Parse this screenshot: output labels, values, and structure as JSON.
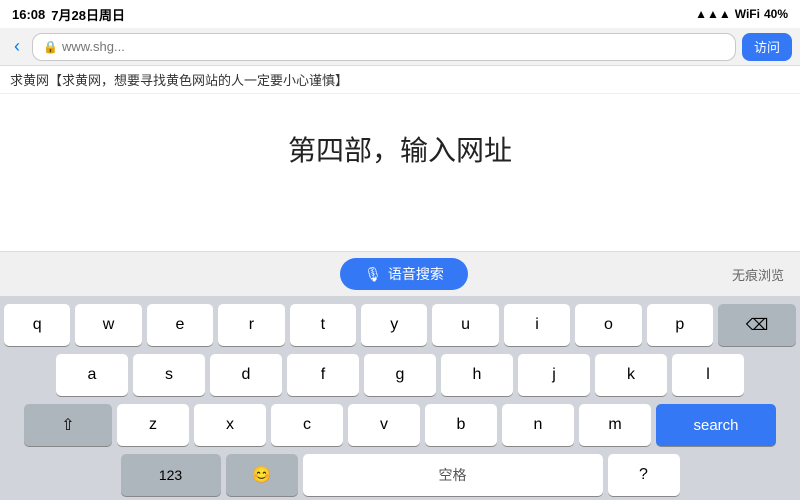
{
  "statusBar": {
    "time": "16:08",
    "date": "7月28日周日",
    "battery": "40%",
    "batteryIcon": "🔋"
  },
  "browserBar": {
    "backIcon": "‹",
    "addressPlaceholder": "www.shg...",
    "visitLabel": "访问"
  },
  "marquee": {
    "text": "求黄网【求黄网，想要寻找黄色网站的人一定要小心谨慎】"
  },
  "mainContent": {
    "title": "第四部，输入网址"
  },
  "voiceBar": {
    "micIcon": "🎙",
    "voiceLabel": "语音搜索",
    "incognitoLabel": "无痕浏览"
  },
  "keyboard": {
    "rows": [
      [
        "q",
        "w",
        "e",
        "r",
        "t",
        "y",
        "u",
        "i",
        "o",
        "p"
      ],
      [
        "a",
        "s",
        "d",
        "f",
        "g",
        "h",
        "j",
        "k",
        "l"
      ],
      [
        "z",
        "x",
        "c",
        "v",
        "b",
        "n",
        "m"
      ]
    ],
    "deleteIcon": "⌫",
    "searchLabel": "search",
    "shiftIcon": "⇧",
    "numbersLabel": "123",
    "emojiLabel": "😊",
    "spaceLabel": "空格",
    "questionLabel": "?"
  }
}
